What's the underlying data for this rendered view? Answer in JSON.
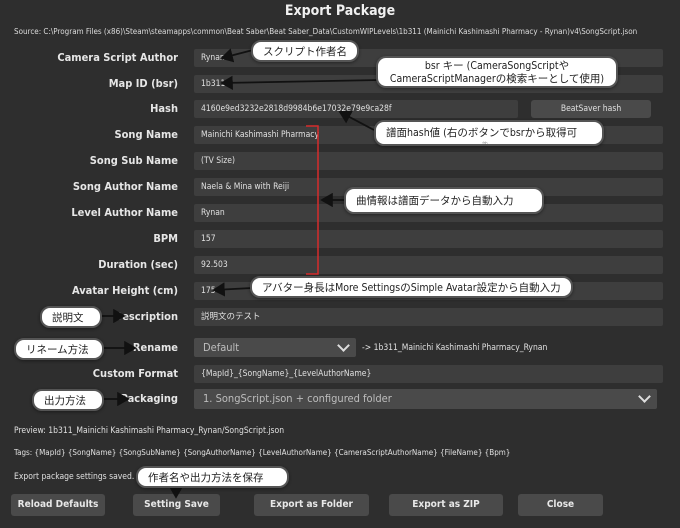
{
  "title": "Export Package",
  "source": "Source: C:\\Program Files (x86)\\Steam\\steamapps\\common\\Beat Saber\\Beat Saber_Data\\CustomWIPLevels\\1b311 (Mainichi Kashimashi Pharmacy - Rynan)v4\\SongScript.json",
  "labels": {
    "camera_script_author": "Camera Script Author",
    "map_id": "Map ID (bsr)",
    "hash": "Hash",
    "song_name": "Song Name",
    "song_sub_name": "Song Sub Name",
    "song_author_name": "Song Author Name",
    "level_author_name": "Level Author Name",
    "bpm": "BPM",
    "duration": "Duration (sec)",
    "avatar_height": "Avatar Height (cm)",
    "description": "Description",
    "rename": "Rename",
    "custom_format": "Custom Format",
    "packaging": "Packaging"
  },
  "values": {
    "camera_script_author": "Rynan",
    "map_id": "1b311",
    "hash": "4160e9ed3232e2818d9984b6e17032e79e9ca28f",
    "song_name": "Mainichi Kashimashi Pharmacy",
    "song_sub_name": "(TV Size)",
    "song_author_name": "Naela & Mina with Reiji",
    "level_author_name": "Rynan",
    "bpm": "157",
    "duration": "92.503",
    "avatar_height": "175",
    "description": "説明文のテスト",
    "rename": "Default",
    "rename_result": "->  1b311_Mainichi Kashimashi Pharmacy_Rynan",
    "custom_format": "{MapId}_{SongName}_{LevelAuthorName}",
    "packaging": "1. SongScript.json + configured folder"
  },
  "beatsaver_hash_button": "BeatSaver hash",
  "preview": "Preview: 1b311_Mainichi Kashimashi Pharmacy_Rynan/SongScript.json",
  "tags": "Tags: {MapId} {SongName} {SongSubName} {SongAuthorName} {LevelAuthorName} {CameraScriptAuthorName} {FileName} {Bpm}",
  "status": "Export package settings saved.",
  "buttons": {
    "reload_defaults": "Reload Defaults",
    "setting_save": "Setting Save",
    "export_folder": "Export as Folder",
    "export_zip": "Export as ZIP",
    "close": "Close"
  },
  "annotations": {
    "author": "スクリプト作者名",
    "bsr_line1": "bsr キー (CameraSongScriptや",
    "bsr_line2": "CameraScriptManagerの検索キーとして使用)",
    "hash": "譜面hash値 (右のボタンでbsrから取得可",
    "hash_faint": "能",
    "song_info": "曲情報は譜面データから自動入力",
    "avatar": "アバター身長はMore SettingsのSimple Avatar設定から自動入力",
    "description": "説明文",
    "rename": "リネーム方法",
    "packaging": "出力方法",
    "save": "作者名や出力方法を保存"
  },
  "colors": {
    "background": "#2e2e2e",
    "field": "#3e3e3e",
    "button": "#4a4a4a",
    "bracket": "#d62b2b"
  }
}
